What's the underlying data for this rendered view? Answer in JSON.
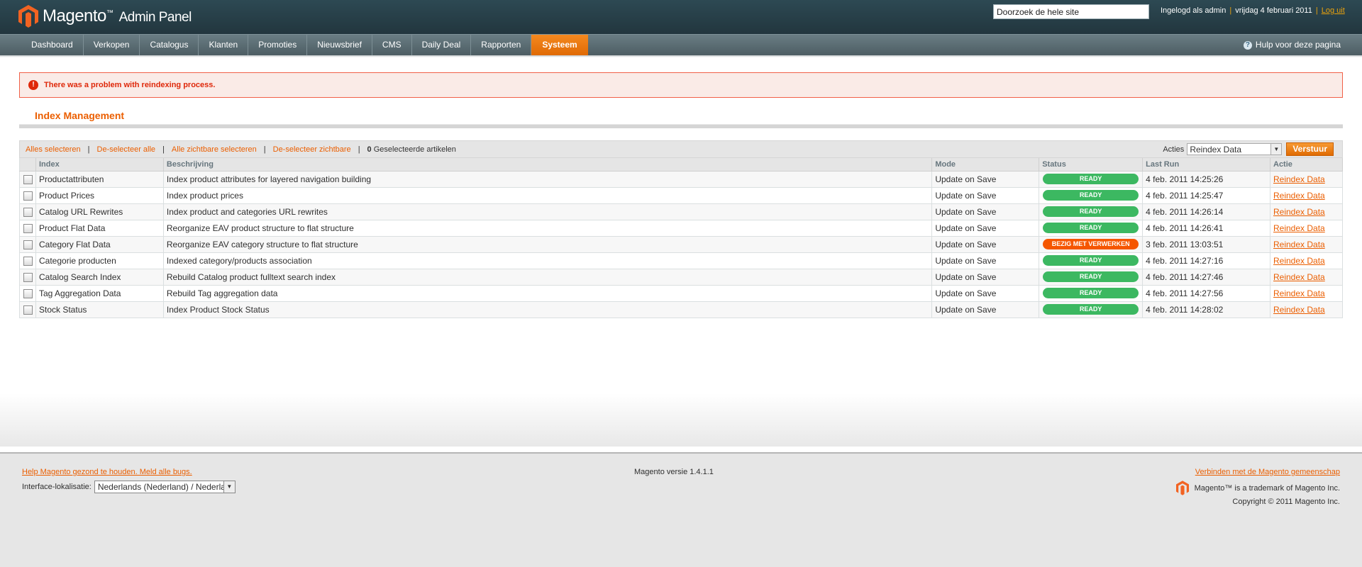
{
  "header": {
    "brand": "Magento",
    "brand_tm": "™",
    "brand_sub": "Admin Panel",
    "search_value": "Doorzoek de hele site",
    "logged_in": "Ingelogd als admin",
    "date": "vrijdag 4 februari 2011",
    "logout": "Log uit",
    "sep": "|",
    "accent_color": "#eaa20c"
  },
  "nav": {
    "items": [
      {
        "label": "Dashboard"
      },
      {
        "label": "Verkopen"
      },
      {
        "label": "Catalogus"
      },
      {
        "label": "Klanten"
      },
      {
        "label": "Promoties"
      },
      {
        "label": "Nieuwsbrief"
      },
      {
        "label": "CMS"
      },
      {
        "label": "Daily Deal"
      },
      {
        "label": "Rapporten"
      },
      {
        "label": "Systeem",
        "active": true
      }
    ],
    "help": "Hulp voor deze pagina",
    "active_color": "#eb5e00"
  },
  "message": {
    "type": "error",
    "text": "There was a problem with reindexing process.",
    "icon": "!"
  },
  "page": {
    "title": "Index Management"
  },
  "massaction": {
    "select_all": "Alles selecteren",
    "unselect_all": "De-selecteer alle",
    "select_visible": "Alle zichtbare selecteren",
    "unselect_visible": "De-selecteer zichtbare",
    "count": "0",
    "count_label": "Geselecteerde artikelen",
    "actions_label": "Acties",
    "action_value": "Reindex Data",
    "submit": "Verstuur",
    "pipe": "|"
  },
  "grid": {
    "columns": [
      "Index",
      "Beschrijving",
      "Mode",
      "Status",
      "Last Run",
      "Actie"
    ],
    "rows": [
      {
        "index": "Productattributen",
        "desc": "Index product attributes for layered navigation building",
        "mode": "Update on Save",
        "status": "READY",
        "status_type": "ready",
        "last_run": "4 feb. 2011 14:25:26",
        "action": "Reindex Data"
      },
      {
        "index": "Product Prices",
        "desc": "Index product prices",
        "mode": "Update on Save",
        "status": "READY",
        "status_type": "ready",
        "last_run": "4 feb. 2011 14:25:47",
        "action": "Reindex Data"
      },
      {
        "index": "Catalog URL Rewrites",
        "desc": "Index product and categories URL rewrites",
        "mode": "Update on Save",
        "status": "READY",
        "status_type": "ready",
        "last_run": "4 feb. 2011 14:26:14",
        "action": "Reindex Data"
      },
      {
        "index": "Product Flat Data",
        "desc": "Reorganize EAV product structure to flat structure",
        "mode": "Update on Save",
        "status": "READY",
        "status_type": "ready",
        "last_run": "4 feb. 2011 14:26:41",
        "action": "Reindex Data"
      },
      {
        "index": "Category Flat Data",
        "desc": "Reorganize EAV category structure to flat structure",
        "mode": "Update on Save",
        "status": "BEZIG MET VERWERKEN",
        "status_type": "busy",
        "last_run": "3 feb. 2011 13:03:51",
        "action": "Reindex Data"
      },
      {
        "index": "Categorie producten",
        "desc": "Indexed category/products association",
        "mode": "Update on Save",
        "status": "READY",
        "status_type": "ready",
        "last_run": "4 feb. 2011 14:27:16",
        "action": "Reindex Data"
      },
      {
        "index": "Catalog Search Index",
        "desc": "Rebuild Catalog product fulltext search index",
        "mode": "Update on Save",
        "status": "READY",
        "status_type": "ready",
        "last_run": "4 feb. 2011 14:27:46",
        "action": "Reindex Data"
      },
      {
        "index": "Tag Aggregation Data",
        "desc": "Rebuild Tag aggregation data",
        "mode": "Update on Save",
        "status": "READY",
        "status_type": "ready",
        "last_run": "4 feb. 2011 14:27:56",
        "action": "Reindex Data"
      },
      {
        "index": "Stock Status",
        "desc": "Index Product Stock Status",
        "mode": "Update on Save",
        "status": "READY",
        "status_type": "ready",
        "last_run": "4 feb. 2011 14:28:02",
        "action": "Reindex Data"
      }
    ],
    "status_colors": {
      "ready": "#3cb861",
      "busy": "#f55600"
    }
  },
  "footer": {
    "bug_link": "Help Magento gezond te houden. Meld alle bugs.",
    "locale_label": "Interface-lokalisatie:",
    "locale_value": "Nederlands (Nederland) / Nederlands (Nederland)",
    "version": "Magento versie 1.4.1.1",
    "community_link": "Verbinden met de Magento gemeenschap",
    "trademark": "Magento™ is a trademark of Magento Inc.",
    "copyright": "Copyright © 2011 Magento Inc."
  }
}
